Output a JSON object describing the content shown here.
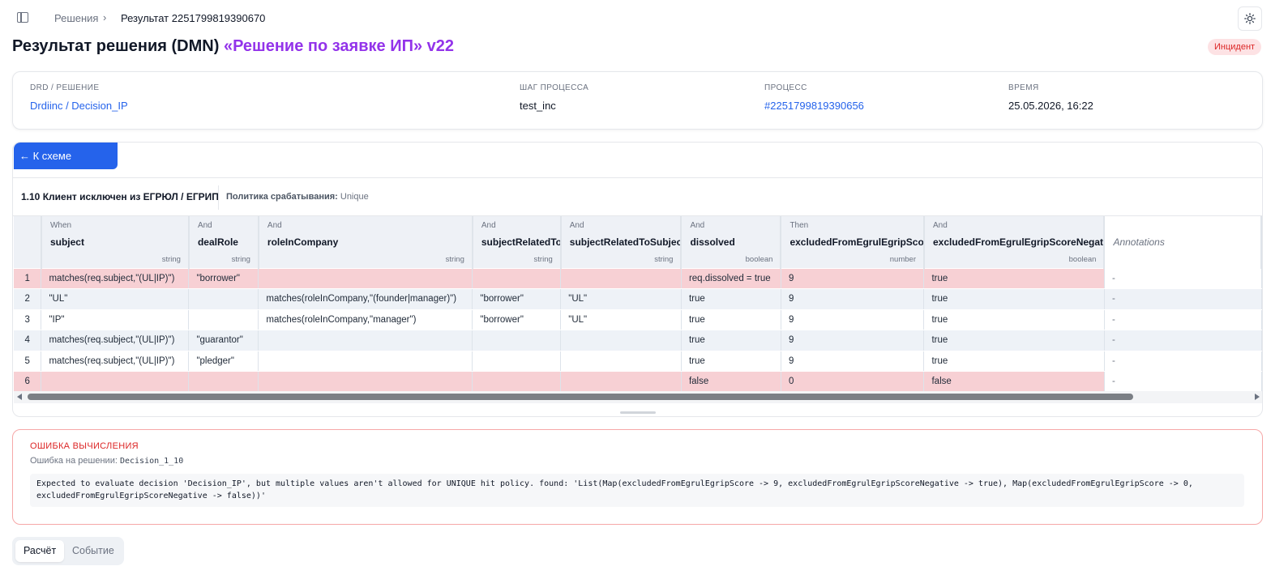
{
  "breadcrumb": {
    "root": "Решения",
    "separator": "›",
    "current": "Результат 2251799819390670"
  },
  "page": {
    "title": "Результат решения (DMN)",
    "title_accent": "«Решение по заявке ИП» v22",
    "status_badge": "Инцидент"
  },
  "info": {
    "drd_label": "DRD / РЕШЕНИЕ",
    "drd_value": "Drdiinc / Decision_IP",
    "step_label": "ШАГ ПРОЦЕССА",
    "step_value": "test_inc",
    "process_label": "ПРОЦЕСС",
    "process_value": "#2251799819390656",
    "time_label": "ВРЕМЯ",
    "time_value": "25.05.2026, 16:22"
  },
  "table": {
    "back_button": "← К схеме решений",
    "decision_name": "1.10 Клиент исключен из ЕГРЮЛ / ЕГРИП",
    "policy_label": "Политика срабатывания:",
    "policy_value": "Unique",
    "annotations_header": "Annotations",
    "columns": [
      {
        "kind": "When",
        "name": "subject",
        "type": "string"
      },
      {
        "kind": "And",
        "name": "dealRole",
        "type": "string"
      },
      {
        "kind": "And",
        "name": "roleInCompany",
        "type": "string"
      },
      {
        "kind": "And",
        "name": "subjectRelatedTo",
        "type": "string"
      },
      {
        "kind": "And",
        "name": "subjectRelatedToSubject",
        "type": "string"
      },
      {
        "kind": "And",
        "name": "dissolved",
        "type": "boolean"
      },
      {
        "kind": "Then",
        "name": "excludedFromEgrulEgripScore",
        "type": "number"
      },
      {
        "kind": "And",
        "name": "excludedFromEgrulEgripScoreNegative",
        "type": "boolean"
      }
    ],
    "rows": [
      {
        "num": "1",
        "hit": true,
        "cells": [
          "matches(req.subject,\"(UL|IP)\")",
          "\"borrower\"",
          "",
          "",
          "",
          "req.dissolved = true",
          "9",
          "true"
        ],
        "annotation": "-"
      },
      {
        "num": "2",
        "hit": false,
        "cells": [
          "\"UL\"",
          "",
          "matches(roleInCompany,\"(founder|manager)\")",
          "\"borrower\"",
          "\"UL\"",
          "true",
          "9",
          "true"
        ],
        "annotation": "-"
      },
      {
        "num": "3",
        "hit": false,
        "cells": [
          "\"IP\"",
          "",
          "matches(roleInCompany,\"manager\")",
          "\"borrower\"",
          "\"UL\"",
          "true",
          "9",
          "true"
        ],
        "annotation": "-"
      },
      {
        "num": "4",
        "hit": false,
        "cells": [
          "matches(req.subject,\"(UL|IP)\")",
          "\"guarantor\"",
          "",
          "",
          "",
          "true",
          "9",
          "true"
        ],
        "annotation": "-"
      },
      {
        "num": "5",
        "hit": false,
        "cells": [
          "matches(req.subject,\"(UL|IP)\")",
          "\"pledger\"",
          "",
          "",
          "",
          "true",
          "9",
          "true"
        ],
        "annotation": "-"
      },
      {
        "num": "6",
        "hit": true,
        "cells": [
          "",
          "",
          "",
          "",
          "",
          "false",
          "0",
          "false"
        ],
        "annotation": "-"
      }
    ]
  },
  "error": {
    "title": "ОШИБКА ВЫЧИСЛЕНИЯ",
    "decision_prefix": "Ошибка на решении:",
    "decision_id": "Decision_1_10",
    "message": "Expected to evaluate decision 'Decision_IP', but multiple values aren't allowed for UNIQUE hit policy. found: 'List(Map(excludedFromEgrulEgripScore -> 9, excludedFromEgrulEgripScoreNegative -> true), Map(excludedFromEgrulEgripScore -> 0, excludedFromEgrulEgripScoreNegative -> false))'"
  },
  "tabs": {
    "calc": "Расчёт",
    "event": "Событие"
  },
  "colors": {
    "accent": "#9333ea",
    "primary": "#2563eb",
    "hit_row": "#f7d0d4",
    "error": "#dc2626"
  }
}
